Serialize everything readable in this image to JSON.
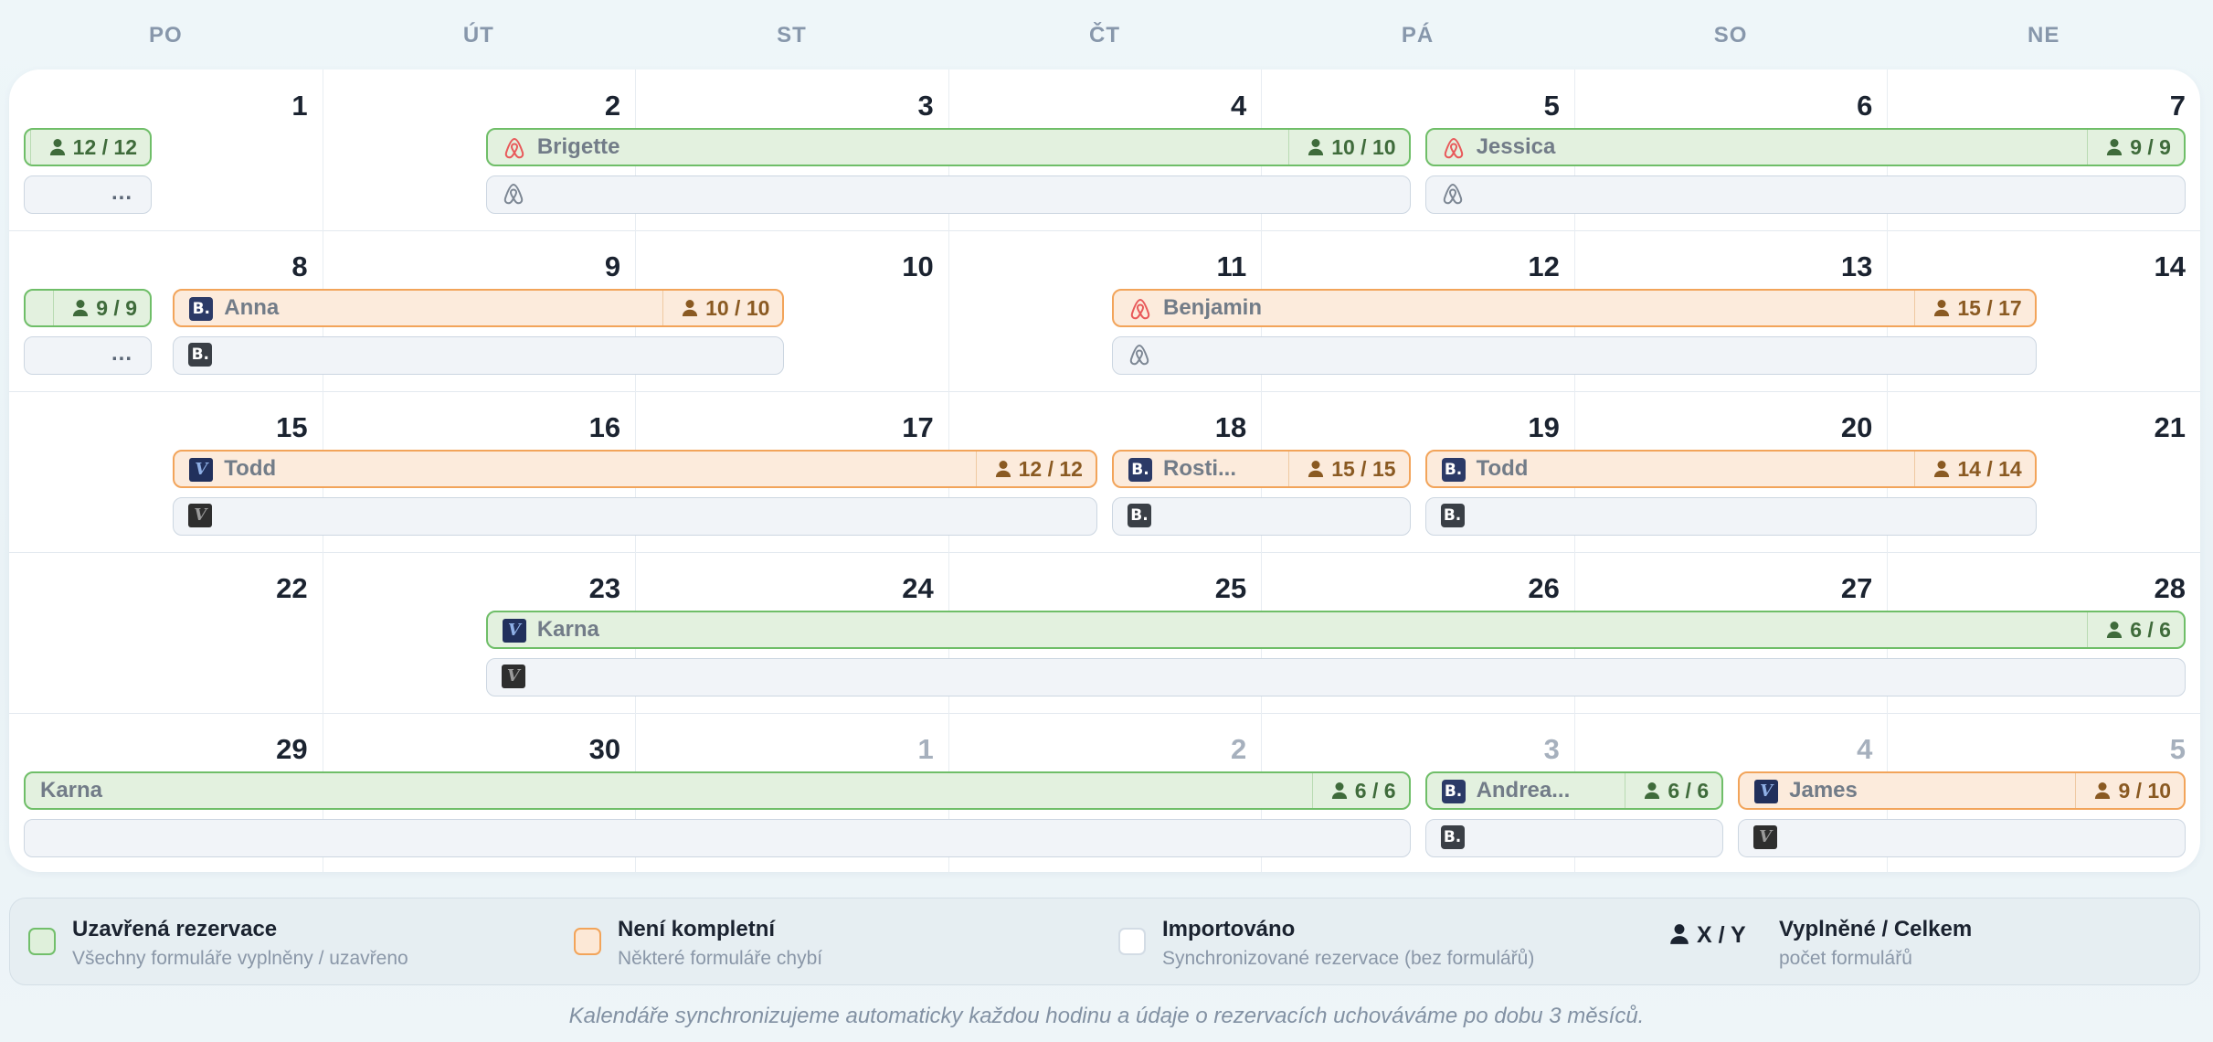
{
  "weekdays": [
    "PO",
    "ÚT",
    "ST",
    "ČT",
    "PÁ",
    "SO",
    "NE"
  ],
  "weeks": [
    {
      "days": [
        {
          "n": "1"
        },
        {
          "n": "2"
        },
        {
          "n": "3"
        },
        {
          "n": "4"
        },
        {
          "n": "5"
        },
        {
          "n": "6"
        },
        {
          "n": "7"
        }
      ],
      "bookings": [
        {
          "type": "green",
          "start": 0,
          "end": 0,
          "clipLeft": true,
          "name": "",
          "count": "12 / 12",
          "icon": "none",
          "subText": "..."
        },
        {
          "type": "green",
          "start": 1,
          "end": 4,
          "startHalf": true,
          "endHalf": true,
          "name": "Brigette",
          "count": "10 / 10",
          "icon": "airbnb"
        },
        {
          "type": "green",
          "start": 4,
          "end": 6,
          "startHalf": true,
          "clipRight": true,
          "name": "Jessica",
          "count": "9 / 9",
          "icon": "airbnb"
        }
      ]
    },
    {
      "days": [
        {
          "n": "8"
        },
        {
          "n": "9"
        },
        {
          "n": "10"
        },
        {
          "n": "11"
        },
        {
          "n": "12"
        },
        {
          "n": "13"
        },
        {
          "n": "14"
        }
      ],
      "bookings": [
        {
          "type": "green",
          "start": 0,
          "end": 0,
          "clipLeft": true,
          "name": "",
          "count": "9 / 9",
          "icon": "none",
          "subText": "..."
        },
        {
          "type": "orange",
          "start": 0,
          "end": 2,
          "startHalf": true,
          "endHalf": true,
          "name": "Anna",
          "count": "10 / 10",
          "icon": "booking"
        },
        {
          "type": "orange",
          "start": 3,
          "end": 6,
          "startHalf": true,
          "endHalf": true,
          "name": "Benjamin",
          "count": "15 / 17",
          "icon": "airbnb"
        }
      ]
    },
    {
      "days": [
        {
          "n": "15"
        },
        {
          "n": "16"
        },
        {
          "n": "17"
        },
        {
          "n": "18"
        },
        {
          "n": "19"
        },
        {
          "n": "20"
        },
        {
          "n": "21"
        }
      ],
      "bookings": [
        {
          "type": "orange",
          "start": 0,
          "end": 3,
          "startHalf": true,
          "endHalf": true,
          "name": "Todd",
          "count": "12 / 12",
          "icon": "vrbo"
        },
        {
          "type": "orange",
          "start": 3,
          "end": 4,
          "startHalf": true,
          "endHalf": true,
          "name": "Rosti...",
          "count": "15 / 15",
          "icon": "booking"
        },
        {
          "type": "orange",
          "start": 4,
          "end": 6,
          "startHalf": true,
          "endHalf": true,
          "name": "Todd",
          "count": "14 / 14",
          "icon": "booking"
        }
      ]
    },
    {
      "days": [
        {
          "n": "22"
        },
        {
          "n": "23"
        },
        {
          "n": "24"
        },
        {
          "n": "25"
        },
        {
          "n": "26"
        },
        {
          "n": "27"
        },
        {
          "n": "28"
        }
      ],
      "bookings": [
        {
          "type": "green",
          "start": 1,
          "end": 6,
          "startHalf": true,
          "clipRight": true,
          "name": "Karna",
          "count": "6 / 6",
          "icon": "vrbo"
        }
      ]
    },
    {
      "days": [
        {
          "n": "29"
        },
        {
          "n": "30"
        },
        {
          "n": "1",
          "other": true
        },
        {
          "n": "2",
          "other": true
        },
        {
          "n": "3",
          "other": true
        },
        {
          "n": "4",
          "other": true
        },
        {
          "n": "5",
          "other": true
        }
      ],
      "bookings": [
        {
          "type": "green",
          "start": 0,
          "end": 4,
          "clipLeft": true,
          "endHalf": true,
          "name": "Karna",
          "count": "6 / 6",
          "icon": "none"
        },
        {
          "type": "green",
          "start": 4,
          "end": 5,
          "startHalf": true,
          "endHalf": true,
          "name": "Andrea...",
          "count": "6 / 6",
          "icon": "booking"
        },
        {
          "type": "orange",
          "start": 5,
          "end": 6,
          "startHalf": true,
          "clipRight": true,
          "name": "James",
          "count": "9 / 10",
          "icon": "vrbo"
        }
      ]
    }
  ],
  "legend": {
    "closed_title": "Uzavřená rezervace",
    "closed_desc": "Všechny formuláře vyplněny / uzavřeno",
    "incomplete_title": "Není kompletní",
    "incomplete_desc": "Některé formuláře chybí",
    "imported_title": "Importováno",
    "imported_desc": "Synchronizované rezervace (bez formulářů)",
    "xy_label": "X / Y",
    "xy_title": "Vyplněné / Celkem",
    "xy_desc": "počet formulářů"
  },
  "footer": "Kalendáře synchronizujeme automaticky každou hodinu a údaje o rezervacích uchováváme po dobu 3 měsíců.",
  "colors": {
    "closed": "#6fbe68",
    "incomplete": "#f2a45a",
    "imported": "#ccd6e1",
    "airbnb": "#e8595a"
  }
}
